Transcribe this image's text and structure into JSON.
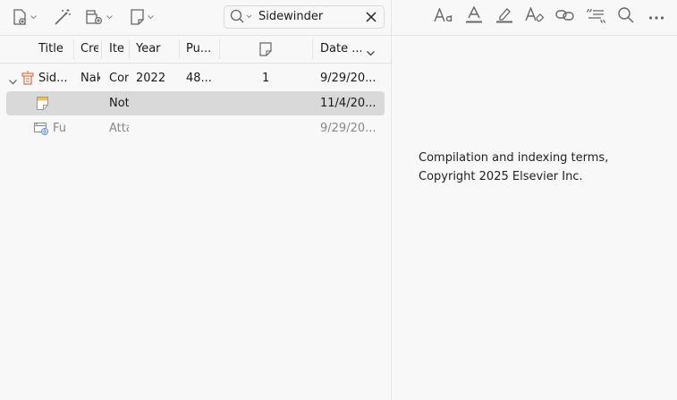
{
  "toolbar": {
    "buttons": [
      "new-item",
      "magic-wand",
      "add-attachment",
      "new-note"
    ],
    "search_value": "Sidewinder"
  },
  "columns": {
    "title": "Title",
    "creator": "Cre",
    "item_type": "Ite",
    "year": "Year",
    "publisher": "Pu...",
    "date": "Date ..."
  },
  "rows": [
    {
      "title": "Sid...",
      "creator": "Nak",
      "item_type": "Cor",
      "year": "2022",
      "publisher": "48...",
      "notes": "1",
      "date": "9/29/20..."
    },
    {
      "title": "",
      "creator": "",
      "item_type": "Not",
      "year": "",
      "publisher": "",
      "notes": "",
      "date": "11/4/20..."
    },
    {
      "title": "Fu",
      "creator": "",
      "item_type": "Atta",
      "year": "",
      "publisher": "",
      "notes": "",
      "date": "9/29/20..."
    }
  ],
  "abstract": {
    "line1": "Compilation and indexing terms,",
    "line2": "Copyright 2025 Elsevier Inc."
  },
  "colors": {
    "selected_row": "#d9d9d9",
    "icon_gray": "#666666",
    "note_yellow": "#f5c542",
    "doc_orange": "#e0704a"
  }
}
